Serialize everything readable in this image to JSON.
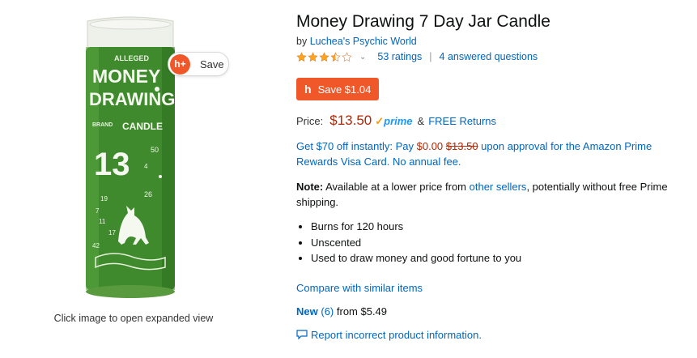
{
  "product": {
    "title": "Money Drawing 7 Day Jar Candle",
    "byline_prefix": "by",
    "brand": "Luchea's Psychic World",
    "rating_value": 3.5,
    "ratings_text": "53 ratings",
    "questions_text": "4 answered questions"
  },
  "image": {
    "click_hint": "Click image to open expanded view",
    "save_label": "Save",
    "save_badge": "h+",
    "label_lines": [
      "ALLEGED",
      "MONEY",
      "DRAWING",
      "BRAND",
      "CANDLE",
      "13"
    ],
    "numbers": [
      "50",
      "4",
      "19",
      "26",
      "7",
      "11",
      "17",
      "42"
    ]
  },
  "coupon": {
    "glyph": "h",
    "label": "Save $1.04"
  },
  "price": {
    "label": "Price:",
    "value": "$13.50",
    "prime_check": "✓",
    "prime_text": "prime",
    "amp": "&",
    "returns": "FREE Returns"
  },
  "offer": {
    "part1": "Get $70 off instantly: Pay ",
    "pay_price": "$0.00",
    "old_price": "$13.50",
    "part2": " upon approval for the Amazon Prime Rewards Visa Card. No annual fee."
  },
  "note": {
    "label": "Note:",
    "text1": " Available at a lower price from ",
    "link": "other sellers",
    "text2": ", potentially without free Prime shipping."
  },
  "bullets": [
    "Burns for 120 hours",
    "Unscented",
    "Used to draw money and good fortune to you"
  ],
  "compare": "Compare with similar items",
  "new_offers": {
    "label": "New",
    "count": "(6)",
    "from": "from $5.49"
  },
  "report": "Report incorrect product information.",
  "colors": {
    "accent_orange": "#f0582a",
    "link_blue": "#0066c0",
    "price_red": "#b12704",
    "candle_green": "#3f8a2c"
  }
}
